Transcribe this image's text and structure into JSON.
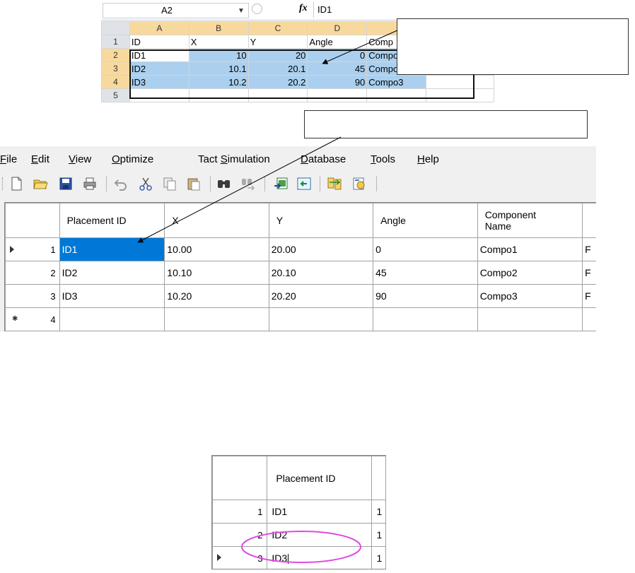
{
  "excel": {
    "name_box": "A2",
    "fx_label": "fx",
    "formula_value": "ID1",
    "col_headers": [
      "A",
      "B",
      "C",
      "D"
    ],
    "row_numbers": [
      "1",
      "2",
      "3",
      "4",
      "5"
    ],
    "rows": [
      [
        "ID",
        "X",
        "Y",
        "Angle",
        "Comp"
      ],
      [
        "ID1",
        "10",
        "20",
        "0",
        "Compo"
      ],
      [
        "ID2",
        "10.1",
        "20.1",
        "45",
        "Compo2"
      ],
      [
        "ID3",
        "10.2",
        "20.2",
        "90",
        "Compo3"
      ]
    ],
    "colors": {
      "header_bg": "#dfe3e8",
      "selected_header_bg": "#f8d99d",
      "selection_bg": "#abd0ef"
    }
  },
  "menu": {
    "items": [
      {
        "pre": "",
        "u": "F",
        "post": "ile"
      },
      {
        "pre": "",
        "u": "E",
        "post": "dit"
      },
      {
        "pre": "",
        "u": "V",
        "post": "iew"
      },
      {
        "pre": "",
        "u": "O",
        "post": "ptimize"
      },
      {
        "pre": "Tact ",
        "u": "S",
        "post": "imulation"
      },
      {
        "pre": "",
        "u": "D",
        "post": "atabase"
      },
      {
        "pre": "",
        "u": "T",
        "post": "ools"
      },
      {
        "pre": "",
        "u": "H",
        "post": "elp"
      }
    ]
  },
  "toolbar": {
    "icons": [
      "new-file-icon",
      "open-folder-icon",
      "save-icon",
      "print-icon",
      "undo-icon",
      "cut-icon",
      "copy-icon",
      "paste-icon",
      "find-icon",
      "find-next-icon",
      "import-icon",
      "export-icon",
      "sync-icon",
      "settings-icon"
    ]
  },
  "grid": {
    "columns": [
      "Placement ID",
      "X",
      "Y",
      "Angle",
      "Component\nName",
      ""
    ],
    "rows": [
      {
        "num": "1",
        "cells": [
          "ID1",
          "10.00",
          "20.00",
          "0",
          "Compo1",
          "F"
        ],
        "current": true
      },
      {
        "num": "2",
        "cells": [
          "ID2",
          "10.10",
          "20.10",
          "45",
          "Compo2",
          "F"
        ],
        "current": false
      },
      {
        "num": "3",
        "cells": [
          "ID3",
          "10.20",
          "20.20",
          "90",
          "Compo3",
          "F"
        ],
        "current": false
      },
      {
        "num": "4",
        "cells": [
          "",
          "",
          "",
          "",
          "",
          ""
        ],
        "current": false,
        "new_row": true
      }
    ],
    "colors": {
      "current_cell_bg": "#0078d7"
    }
  },
  "grid2": {
    "column": "Placement ID",
    "rows": [
      {
        "num": "1",
        "value": "ID1",
        "next": "1"
      },
      {
        "num": "2",
        "value": "ID2",
        "next": "1"
      },
      {
        "num": "3",
        "value": "ID3",
        "next": "1",
        "editing": true
      }
    ],
    "highlight_color": "#e04be0"
  }
}
